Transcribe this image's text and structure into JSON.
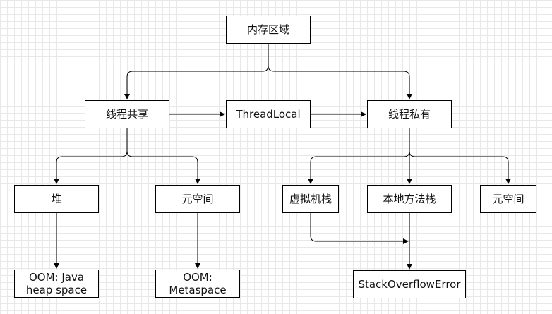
{
  "nodes": {
    "memory_area": "内存区域",
    "thread_shared": "线程共享",
    "threadlocal": "ThreadLocal",
    "thread_private": "线程私有",
    "heap": "堆",
    "metaspace_shared": "元空间",
    "vm_stack": "虚拟机栈",
    "native_method_stack": "本地方法栈",
    "metaspace_private": "元空间",
    "oom_heap": "OOM: Java\nheap space",
    "oom_metaspace": "OOM:\nMetaspace",
    "stack_overflow": "StackOverflowError"
  },
  "colors": {
    "stroke": "#000000",
    "grid": "#e8e8e8",
    "background": "#ffffff"
  }
}
